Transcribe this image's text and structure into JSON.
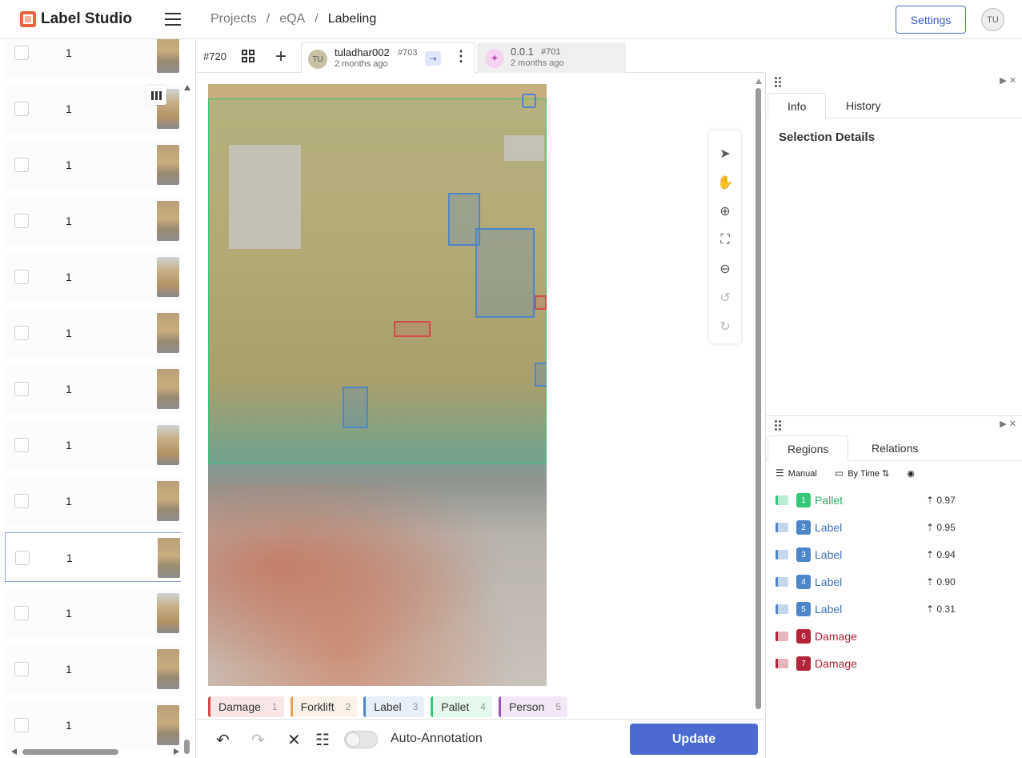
{
  "header": {
    "app_name": "Label Studio",
    "breadcrumbs": [
      "Projects",
      "eQA",
      "Labeling"
    ],
    "settings_label": "Settings",
    "user_initials": "TU"
  },
  "task_list": {
    "rows": [
      {
        "value": "1"
      },
      {
        "value": "1"
      },
      {
        "value": "1"
      },
      {
        "value": "1"
      },
      {
        "value": "1"
      },
      {
        "value": "1"
      },
      {
        "value": "1"
      },
      {
        "value": "1"
      },
      {
        "value": "1"
      },
      {
        "value": "1"
      },
      {
        "value": "1"
      },
      {
        "value": "1"
      },
      {
        "value": "1"
      }
    ],
    "selected_index": 9
  },
  "tabs": {
    "task_id": "#720",
    "annotation": {
      "avatar": "TU",
      "user": "tuladhar002",
      "id": "#703",
      "time": "2 months ago"
    },
    "prediction": {
      "avatar": "✦",
      "version": "0.0.1",
      "id": "#701",
      "time": "2 months ago"
    }
  },
  "labels": [
    {
      "name": "Damage",
      "key": "1",
      "color": "#d34a4a"
    },
    {
      "name": "Forklift",
      "key": "2",
      "color": "#f0a050"
    },
    {
      "name": "Label",
      "key": "3",
      "color": "#4f86c9"
    },
    {
      "name": "Pallet",
      "key": "4",
      "color": "#34c77a"
    },
    {
      "name": "Person",
      "key": "5",
      "color": "#9b4fc0"
    }
  ],
  "bottom": {
    "auto_annotation_label": "Auto-Annotation",
    "update_label": "Update"
  },
  "info_panel": {
    "tabs": [
      "Info",
      "History"
    ],
    "selection_title": "Selection Details"
  },
  "regions_panel": {
    "tabs": [
      "Regions",
      "Relations"
    ],
    "sort_manual": "Manual",
    "sort_time": "By Time",
    "regions": [
      {
        "idx": "1",
        "label": "Pallet",
        "score": "0.97",
        "color": "#34c77a",
        "text_color": "#2fae6a"
      },
      {
        "idx": "2",
        "label": "Label",
        "score": "0.95",
        "color": "#4f86c9",
        "text_color": "#3e72b8"
      },
      {
        "idx": "3",
        "label": "Label",
        "score": "0.94",
        "color": "#4f86c9",
        "text_color": "#3e72b8"
      },
      {
        "idx": "4",
        "label": "Label",
        "score": "0.90",
        "color": "#4f86c9",
        "text_color": "#3e72b8"
      },
      {
        "idx": "5",
        "label": "Label",
        "score": "0.31",
        "color": "#4f86c9",
        "text_color": "#3e72b8"
      },
      {
        "idx": "6",
        "label": "Damage",
        "score": "",
        "color": "#b3243a",
        "text_color": "#a82236"
      },
      {
        "idx": "7",
        "label": "Damage",
        "score": "",
        "color": "#b3243a",
        "text_color": "#a82236"
      }
    ]
  }
}
